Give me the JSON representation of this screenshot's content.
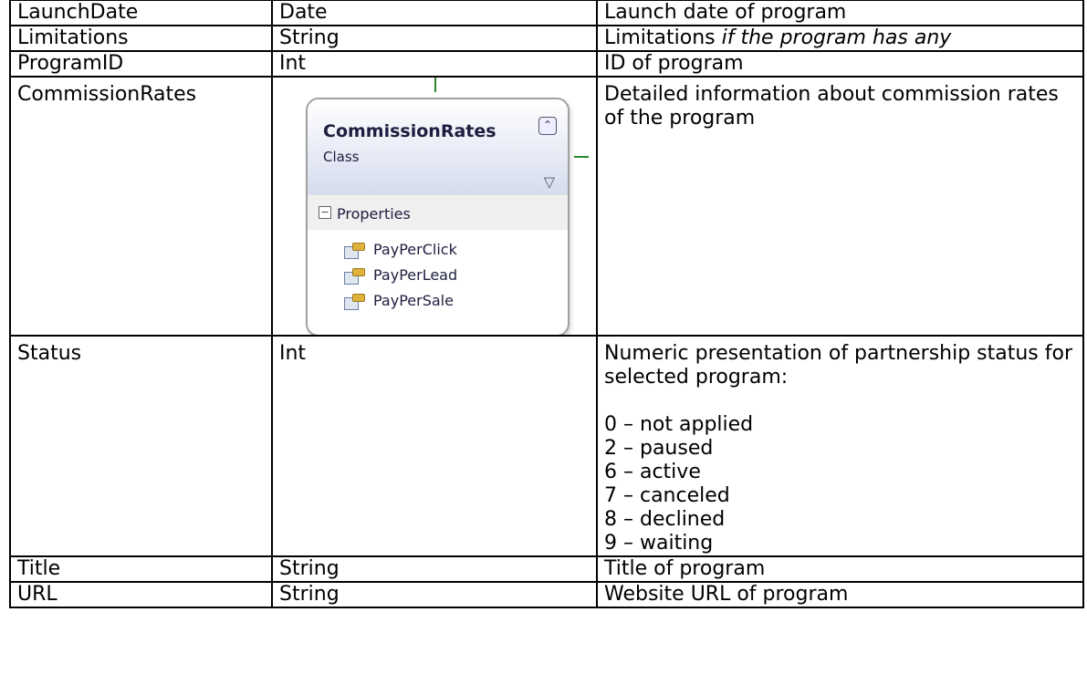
{
  "rows": [
    {
      "name": "LaunchDate",
      "type": "Date",
      "desc": "Launch date of program"
    },
    {
      "name": "Limitations",
      "type": "String",
      "desc_plain": "Limitations ",
      "desc_italic": "if the program has any"
    },
    {
      "name": "ProgramID",
      "type": "Int",
      "desc": "ID of program"
    },
    {
      "name": "CommissionRates",
      "desc": "Detailed information about commission rates of the program"
    },
    {
      "name": "Status",
      "type": "Int",
      "desc_intro": "Numeric presentation of partnership status for selected program:",
      "status_values": [
        "0 – not applied",
        "2 – paused",
        "6 – active",
        "7 – canceled",
        "8 – declined",
        "9 – waiting"
      ]
    },
    {
      "name": "Title",
      "type": "String",
      "desc": "Title of program"
    },
    {
      "name": "URL",
      "type": "String",
      "desc": "Website URL of program"
    }
  ],
  "diagram": {
    "class_name": "CommissionRates",
    "kind": "Class",
    "section": "Properties",
    "properties": [
      "PayPerClick",
      "PayPerLead",
      "PayPerSale"
    ],
    "icons": {
      "collapse": "double-chevron-up-icon",
      "filter": "filter-icon",
      "toggle": "minus-box-icon",
      "property": "property-icon"
    }
  }
}
